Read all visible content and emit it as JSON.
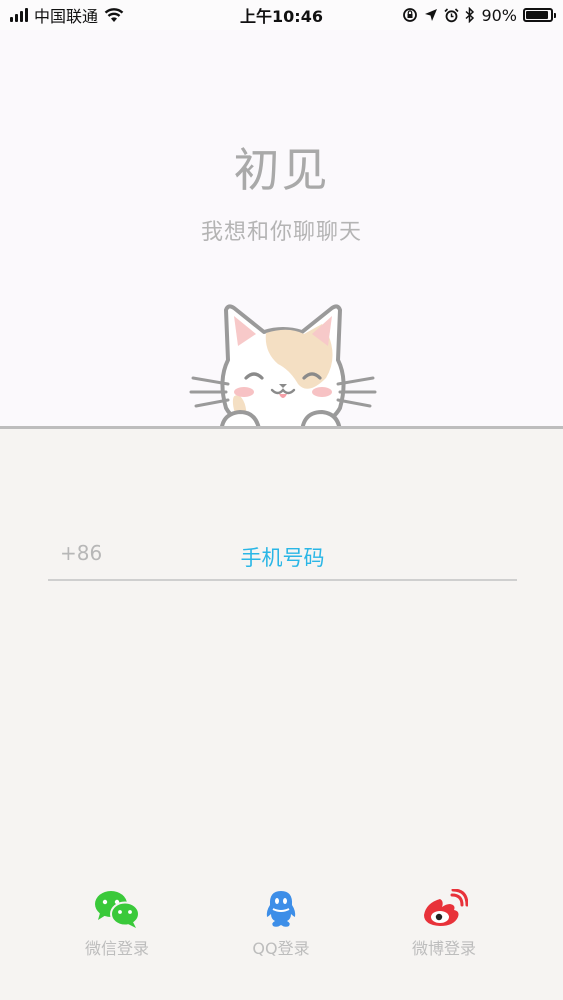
{
  "status_bar": {
    "carrier": "中国联通",
    "time": "上午10:46",
    "battery": "90%",
    "battery_level": 0.9
  },
  "hero": {
    "title": "初见",
    "subtitle": "我想和你聊聊天"
  },
  "phone_login": {
    "country_code": "+86",
    "placeholder": "手机号码",
    "value": ""
  },
  "social_login": [
    {
      "label": "微信登录",
      "icon": "wechat-icon",
      "color": "#3ac93a"
    },
    {
      "label": "QQ登录",
      "icon": "qq-icon",
      "color": "#3d8ee8"
    },
    {
      "label": "微博登录",
      "icon": "weibo-icon",
      "color": "#e8323a"
    }
  ],
  "colors": {
    "accent": "#2ab6e6",
    "muted_text": "#b4b4b4",
    "upper_bg": "#fbf9fc",
    "lower_bg": "#f6f4f2"
  }
}
